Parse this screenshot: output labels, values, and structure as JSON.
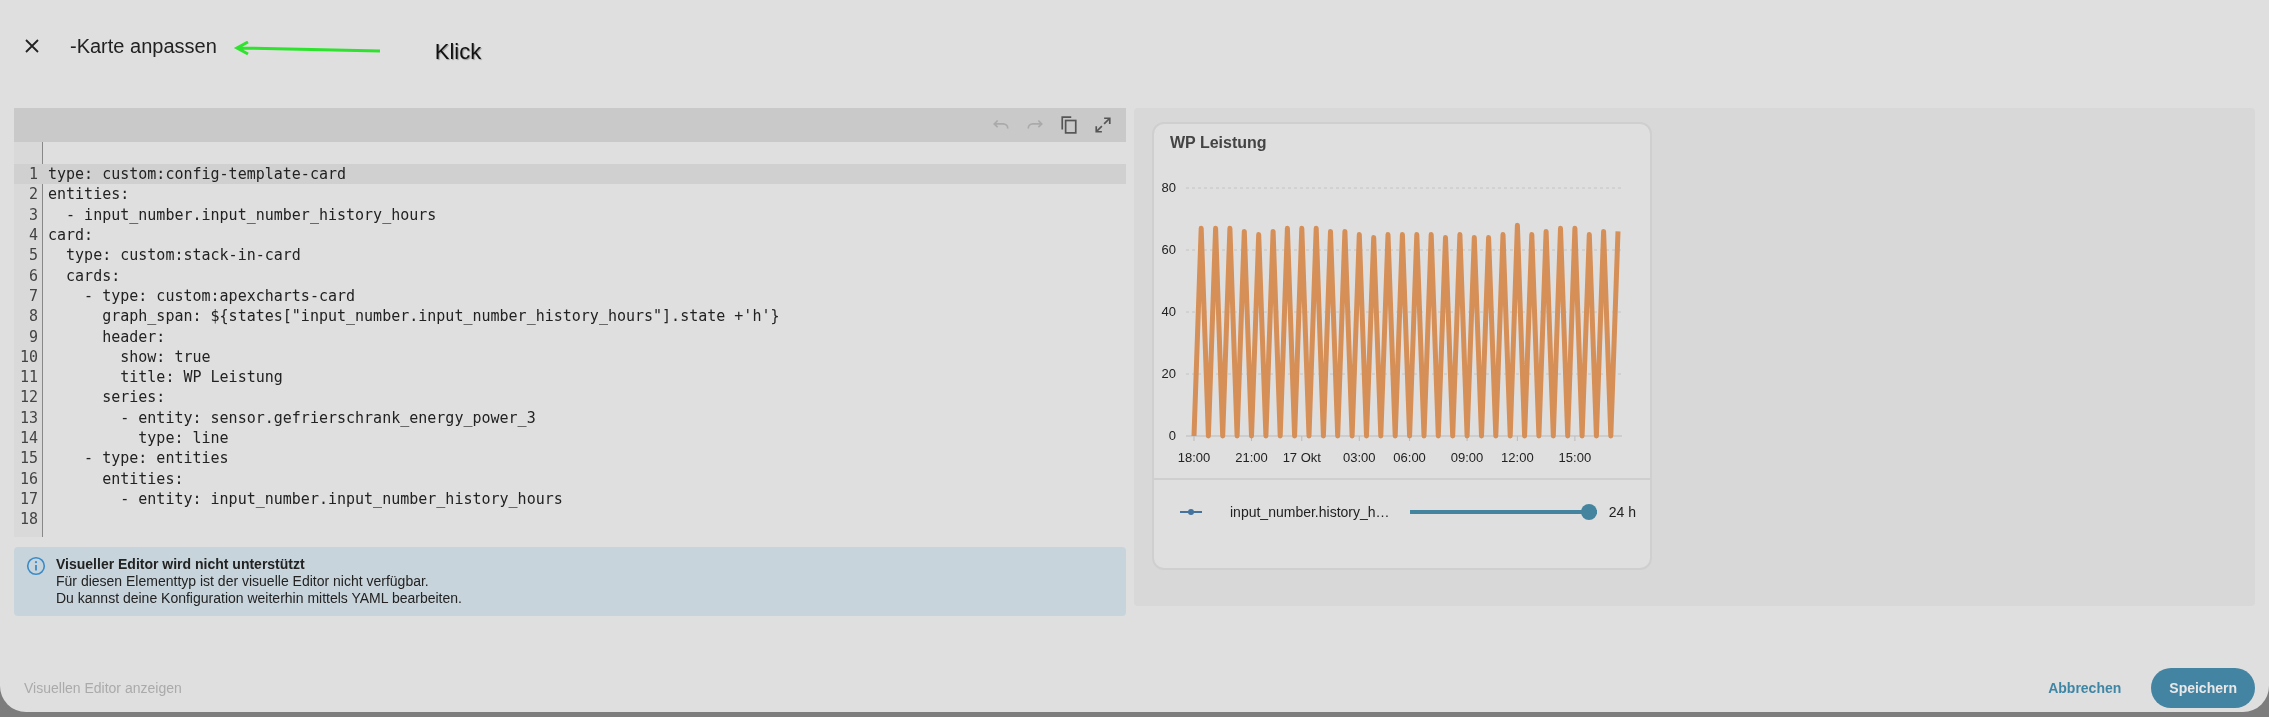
{
  "dialog": {
    "title": "-Karte anpassen",
    "annotation": "Klick"
  },
  "editor": {
    "lines": [
      {
        "number": "1",
        "text": "type: custom:config-template-card",
        "active": true
      },
      {
        "number": "2",
        "text": "entities:",
        "active": false
      },
      {
        "number": "3",
        "text": "  - input_number.input_number_history_hours",
        "active": false
      },
      {
        "number": "4",
        "text": "card:",
        "active": false
      },
      {
        "number": "5",
        "text": "  type: custom:stack-in-card",
        "active": false
      },
      {
        "number": "6",
        "text": "  cards:",
        "active": false
      },
      {
        "number": "7",
        "text": "    - type: custom:apexcharts-card",
        "active": false
      },
      {
        "number": "8",
        "text": "      graph_span: ${states[\"input_number.input_number_history_hours\"].state +'h'}",
        "active": false
      },
      {
        "number": "9",
        "text": "      header:",
        "active": false
      },
      {
        "number": "10",
        "text": "        show: true",
        "active": false
      },
      {
        "number": "11",
        "text": "        title: WP Leistung",
        "active": false
      },
      {
        "number": "12",
        "text": "      series:",
        "active": false
      },
      {
        "number": "13",
        "text": "        - entity: sensor.gefrierschrank_energy_power_3",
        "active": false
      },
      {
        "number": "14",
        "text": "          type: line",
        "active": false
      },
      {
        "number": "15",
        "text": "    - type: entities",
        "active": false
      },
      {
        "number": "16",
        "text": "      entities:",
        "active": false
      },
      {
        "number": "17",
        "text": "        - entity: input_number.input_number_history_hours",
        "active": false
      },
      {
        "number": "18",
        "active": false
      }
    ]
  },
  "notice": {
    "title": "Visueller Editor wird nicht unterstützt",
    "lines": [
      "Für diesen Elementtyp ist der visuelle Editor nicht verfügbar.",
      "Du kannst deine Konfiguration weiterhin mittels YAML bearbeiten."
    ]
  },
  "preview": {
    "card": {
      "title": "WP Leistung",
      "chart_data": {
        "type": "line",
        "grid": true,
        "ylim": [
          0,
          80
        ],
        "yticks": [
          0,
          20,
          40,
          60,
          80
        ],
        "categories": [
          "18:00",
          null,
          null,
          null,
          null,
          null,
          null,
          null,
          "21:00",
          null,
          null,
          null,
          null,
          null,
          null,
          "17 Okt",
          null,
          null,
          null,
          null,
          null,
          null,
          null,
          "03:00",
          null,
          null,
          null,
          null,
          null,
          null,
          "06:00",
          null,
          null,
          null,
          null,
          null,
          null,
          null,
          "09:00",
          null,
          null,
          null,
          null,
          null,
          null,
          "12:00",
          null,
          null,
          null,
          null,
          null,
          null,
          null,
          "15:00",
          null,
          null,
          null,
          null,
          null,
          null
        ],
        "series": [
          {
            "color": "#d58f57",
            "values": [
              0,
              67,
              0,
              67,
              0,
              67,
              0,
              66,
              0,
              65,
              0,
              66,
              0,
              67,
              0,
              67,
              0,
              67,
              0,
              66,
              0,
              66,
              0,
              65,
              0,
              64,
              0,
              65,
              0,
              65,
              0,
              65,
              0,
              65,
              0,
              64,
              0,
              65,
              0,
              64,
              0,
              64,
              0,
              65,
              0,
              68,
              0,
              65,
              0,
              66,
              0,
              67,
              0,
              67,
              0,
              65,
              0,
              66,
              0,
              66
            ]
          }
        ]
      }
    },
    "entity": {
      "name": "input_number.history_h…",
      "level": 1,
      "value": "24 h"
    }
  },
  "footer": {
    "toggle": "Visuellen Editor anzeigen",
    "cancel": "Abbrechen",
    "save": "Speichern"
  }
}
